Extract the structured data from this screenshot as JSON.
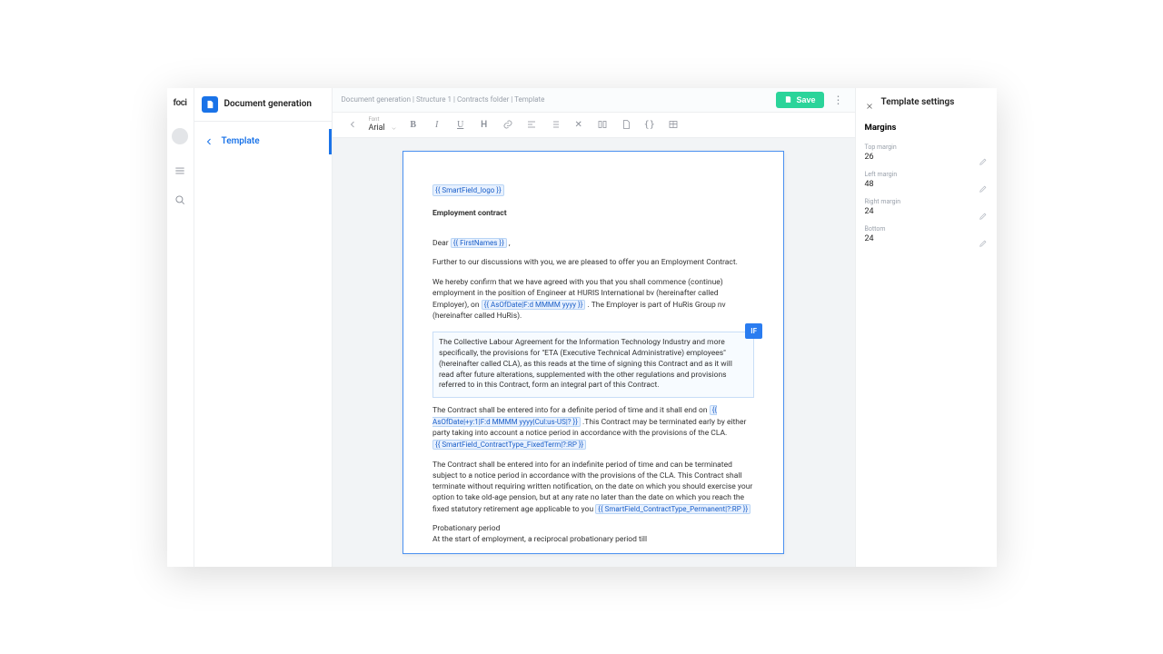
{
  "logo": "foci",
  "header": {
    "title": "Document generation",
    "nav_item": "Template"
  },
  "breadcrumbs": "Document generation | Structure 1 | Contracts folder | Template",
  "save_label": "Save",
  "toolbar": {
    "font_label": "Font",
    "font_value": "Arial",
    "bold": "B",
    "italic": "I",
    "underline": "U",
    "heading": "H"
  },
  "document": {
    "logo_field": "{{ SmartField_logo }}",
    "title": "Employment contract",
    "salutation_pre": "Dear ",
    "salutation_field": "{{ FirstNames }}",
    "salutation_post": " ,",
    "para1": "Further to our discussions with you, we are pleased to offer you an Employment Contract.",
    "para2_a": "We hereby confirm that we have agreed with you that you shall commence (continue) employment in the position of Engineer at HURIS International bv (hereinafter called Employer), on ",
    "para2_field": "{{ AsOfDate|F:d MMMM yyyy }}",
    "para2_b": " . The Employer is part of HuRis Group nv (hereinafter called HuRis).",
    "if_label": "IF",
    "cond1": "The Collective Labour Agreement for the Information Technology Industry and more specifically, the provisions for \"ETA (Executive Technical Administrative) employees\" (hereinafter called CLA), as this reads at the time of signing this Contract and as it will read after future alterations, supplemented with the other regulations and provisions referred to in this Contract, form an integral part of this Contract.",
    "para3_a": "The Contract shall be entered into for a definite period of time and it shall end on ",
    "para3_field": "{{ AsOfDate|+y:1|F:d MMMM yyyy|Cul:us-US|? }}",
    "para3_b": " .This Contract may be terminated early by either party taking into account a notice period in accordance with the provisions of the CLA.",
    "para3_field2": "{{ SmartField_ContractType_FixedTerm|?:RP }}",
    "para4_a": "The Contract shall be entered into for an indefinite period of time and can be terminated subject to a notice period in accordance with the provisions of the CLA. This Contract shall terminate without requiring written notification, on the date on which you should exercise your option to take old-age pension, but at any rate no later than the date on which you reach the fixed statutory retirement age applicable to you ",
    "para4_field": "{{ SmartField_ContractType_Permanent|?:RP }}",
    "para5_title": "Probationary period",
    "para5_a": "At the start of employment, a reciprocal probationary period till"
  },
  "right_panel": {
    "title": "Template settings",
    "section": "Margins",
    "margins": [
      {
        "label": "Top margin",
        "value": "26"
      },
      {
        "label": "Left margin",
        "value": "48"
      },
      {
        "label": "Right margin",
        "value": "24"
      },
      {
        "label": "Bottom",
        "value": "24"
      }
    ]
  }
}
